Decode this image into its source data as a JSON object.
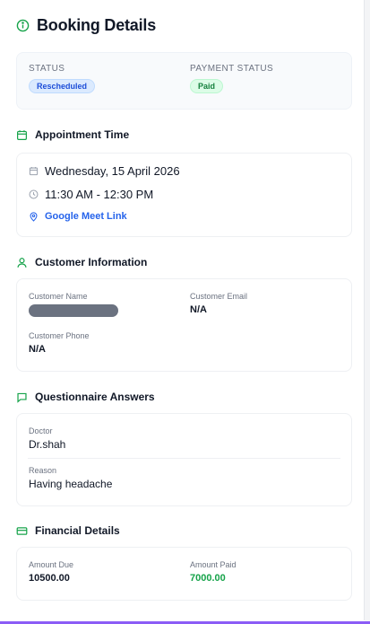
{
  "header": {
    "title": "Booking Details",
    "icon": "info-icon"
  },
  "status": {
    "status_label": "STATUS",
    "status_value": "Rescheduled",
    "payment_label": "PAYMENT STATUS",
    "payment_value": "Paid"
  },
  "appointment": {
    "title": "Appointment Time",
    "date": "Wednesday, 15 April 2026",
    "time": "11:30 AM - 12:30 PM",
    "link_label": "Google Meet Link"
  },
  "customer": {
    "title": "Customer Information",
    "name_label": "Customer Name",
    "email_label": "Customer Email",
    "email_value": "N/A",
    "phone_label": "Customer Phone",
    "phone_value": "N/A"
  },
  "questionnaire": {
    "title": "Questionnaire Answers",
    "items": [
      {
        "label": "Doctor",
        "value": "Dr.shah"
      },
      {
        "label": "Reason",
        "value": "Having headache"
      }
    ]
  },
  "financial": {
    "title": "Financial Details",
    "due_label": "Amount Due",
    "due_value": "10500.00",
    "paid_label": "Amount Paid",
    "paid_value": "7000.00"
  },
  "colors": {
    "accent_green": "#16a34a",
    "link_blue": "#2563eb",
    "bottom_accent": "#8b5cf6"
  }
}
